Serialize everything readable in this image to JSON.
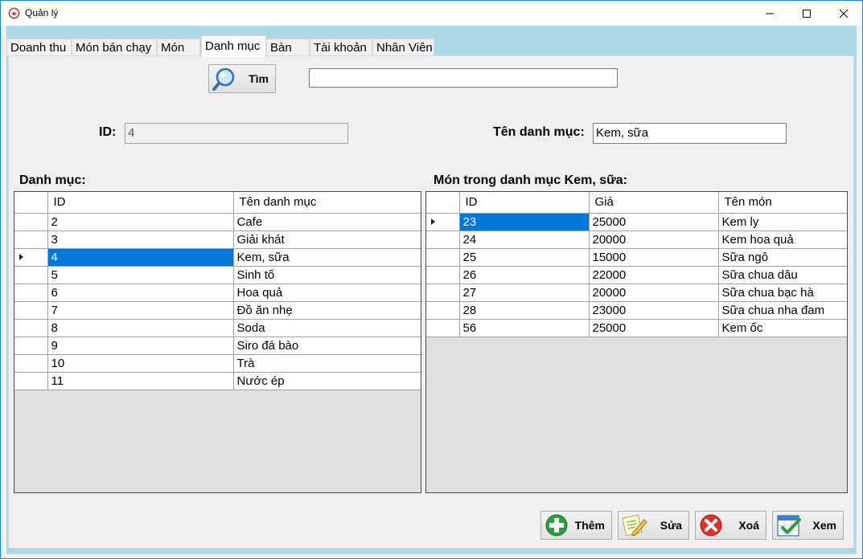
{
  "window": {
    "title": "Quản lý"
  },
  "tabs": [
    "Doanh thu",
    "Món bán chạy",
    "Món",
    "Danh mục",
    "Bàn",
    "Tài khoản",
    "Nhân Viên"
  ],
  "active_tab": "Danh mục",
  "search": {
    "button_label": "Tìm",
    "value": ""
  },
  "form": {
    "id_label": "ID:",
    "id_value": "4",
    "name_label": "Tên danh mục:",
    "name_value": "Kem, sữa"
  },
  "categories_grid": {
    "title": "Danh mục:",
    "columns": [
      "ID",
      "Tên danh mục"
    ],
    "rows": [
      [
        "2",
        "Cafe"
      ],
      [
        "3",
        "Giải khát"
      ],
      [
        "4",
        "Kem, sữa"
      ],
      [
        "5",
        "Sinh tố"
      ],
      [
        "6",
        "Hoa quả"
      ],
      [
        "7",
        "Đồ ăn nhẹ"
      ],
      [
        "8",
        "Soda"
      ],
      [
        "9",
        "Siro đá bào"
      ],
      [
        "10",
        "Trà"
      ],
      [
        "11",
        "Nước ép"
      ]
    ],
    "selected_row": 2
  },
  "items_grid": {
    "title": "Món trong danh mục Kem, sữa:",
    "columns": [
      "ID",
      "Giá",
      "Tên món"
    ],
    "rows": [
      [
        "23",
        "25000",
        "Kem ly"
      ],
      [
        "24",
        "20000",
        "Kem hoa quả"
      ],
      [
        "25",
        "15000",
        "Sữa ngô"
      ],
      [
        "26",
        "22000",
        "Sữa chua dâu"
      ],
      [
        "27",
        "20000",
        "Sữa chua bạc hà"
      ],
      [
        "28",
        "23000",
        "Sữa chua nha đam"
      ],
      [
        "56",
        "25000",
        "Kem ốc"
      ]
    ],
    "selected_row": 0
  },
  "actions": {
    "add": "Thêm",
    "edit": "Sửa",
    "delete": "Xoá",
    "view": "Xem"
  },
  "colors": {
    "selection": "#0078d7",
    "window_border": "#1e86c9",
    "client_bg": "#add8e6"
  }
}
